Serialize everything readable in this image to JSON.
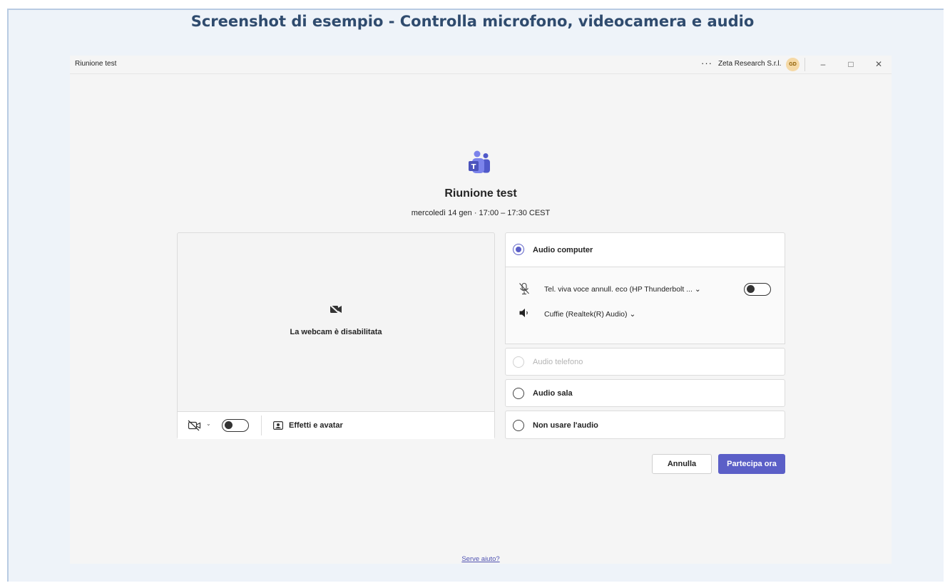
{
  "doc_title": "Screenshot di esempio - Controlla microfono, videocamera e audio",
  "window": {
    "title": "Riunione test",
    "more_label": "···",
    "org_name": "Zeta Research S.r.l.",
    "avatar_initials": "GD",
    "minimize_glyph": "–",
    "maximize_glyph": "□",
    "close_glyph": "✕"
  },
  "meeting": {
    "title": "Riunione test",
    "time": "mercoledì 14 gen · 17:00 – 17:30 CEST"
  },
  "video": {
    "disabled_text": "La webcam è disabilitata",
    "camera_toggle_on": false,
    "chevron": "⌄",
    "effects_label": "Effetti e avatar"
  },
  "audio": {
    "options": [
      {
        "label": "Audio computer",
        "selected": true,
        "enabled": true
      },
      {
        "label": "Audio telefono",
        "selected": false,
        "enabled": false
      },
      {
        "label": "Audio sala",
        "selected": false,
        "enabled": true
      },
      {
        "label": "Non usare l'audio",
        "selected": false,
        "enabled": true
      }
    ],
    "microphone": "Tel. viva voce annull. eco (HP Thunderbolt ... ⌄",
    "mic_toggle_on": false,
    "speaker": "Cuffie (Realtek(R) Audio) ⌄"
  },
  "actions": {
    "cancel": "Annulla",
    "join": "Partecipa ora"
  },
  "help_link": "Serve aiuto?",
  "colors": {
    "accent": "#5b5fc7",
    "frame_background": "#eef3f9",
    "app_background": "#f5f5f5",
    "doc_title": "#2f4b6e"
  },
  "icons": [
    "teams-logo",
    "camera-off-icon",
    "effects-icon",
    "microphone-muted-icon",
    "speaker-icon"
  ]
}
